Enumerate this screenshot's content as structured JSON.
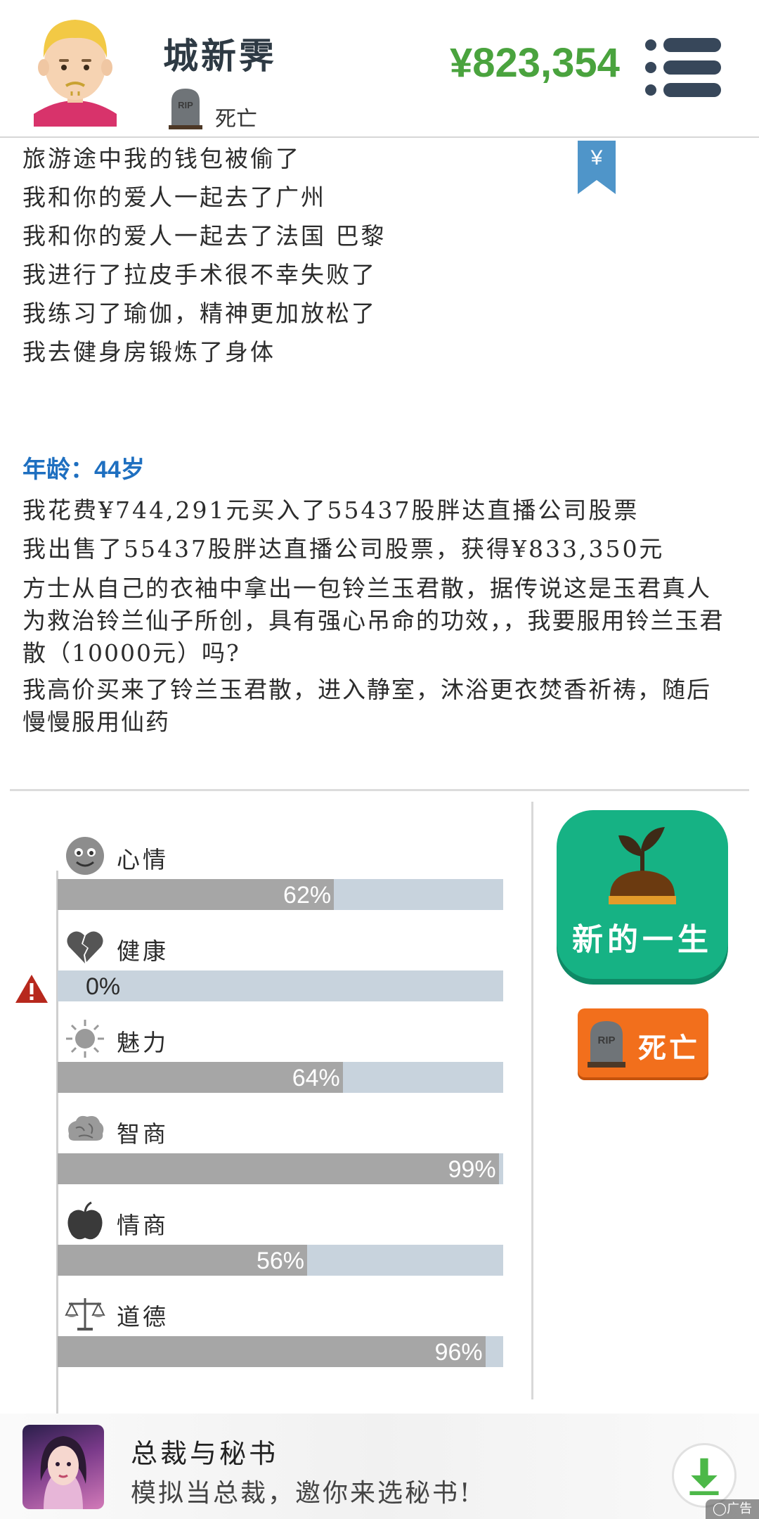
{
  "header": {
    "player_name": "城新霁",
    "status_text": "死亡",
    "money": "¥823,354",
    "money_color": "#4aa33e",
    "status_icon": "tombstone-icon",
    "menu_icon": "hamburger-menu-icon"
  },
  "log": {
    "lines_before": [
      "旅游途中我的钱包被偷了",
      "我和你的爱人一起去了广州",
      "我和你的爱人一起去了法国 巴黎",
      "我进行了拉皮手术很不幸失败了",
      "我练习了瑜伽，精神更加放松了",
      "我去健身房锻炼了身体"
    ],
    "age_heading": "年龄：44岁",
    "lines_after": [
      "我花费¥744,291元买入了55437股胖达直播公司股票",
      "我出售了55437股胖达直播公司股票，获得¥833,350元",
      "方士从自己的衣袖中拿出一包铃兰玉君散，据传说这是玉君真人为救治铃兰仙子所创，具有强心吊命的功效，，我要服用铃兰玉君散（10000元）吗?",
      "我高价买来了铃兰玉君散，进入静室，沐浴更衣焚香祈祷，随后慢慢服用仙药"
    ],
    "bookmark_icon": "yen-bookmark-icon",
    "bookmark_symbol": "¥"
  },
  "stats": [
    {
      "label": "心情",
      "value": 62,
      "display": "62%",
      "icon": "smiley-icon"
    },
    {
      "label": "健康",
      "value": 0,
      "display": "0%",
      "icon": "broken-heart-icon"
    },
    {
      "label": "魅力",
      "value": 64,
      "display": "64%",
      "icon": "sun-icon"
    },
    {
      "label": "智商",
      "value": 99,
      "display": "99%",
      "icon": "brain-icon"
    },
    {
      "label": "情商",
      "value": 56,
      "display": "56%",
      "icon": "apple-icon"
    },
    {
      "label": "道德",
      "value": 96,
      "display": "96%",
      "icon": "scales-icon"
    }
  ],
  "buttons": {
    "new_life": "新的一生",
    "new_life_color": "#16b284",
    "death": "死亡",
    "death_color": "#f26f1c"
  },
  "ad": {
    "title": "总裁与秘书",
    "subtitle": "模拟当总裁，邀你来选秘书!",
    "mark": "◯广告"
  }
}
